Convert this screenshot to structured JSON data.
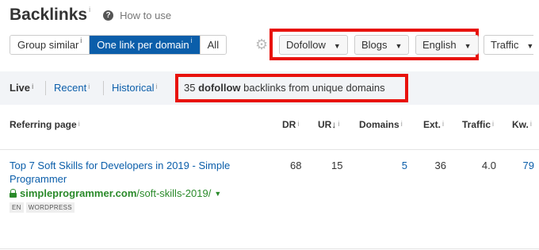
{
  "header": {
    "title": "Backlinks",
    "title_sup": "i",
    "how_to_use": "How to use",
    "help_icon": "?"
  },
  "grouping": {
    "buttons": [
      {
        "label": "Group similar",
        "sup": "i"
      },
      {
        "label": "One link per domain",
        "sup": "i"
      },
      {
        "label": "All",
        "sup": ""
      }
    ],
    "active": "One link per domain"
  },
  "filters": {
    "link_type": "Dofollow",
    "category": "Blogs",
    "language": "English",
    "traffic": "Traffic"
  },
  "tabs": {
    "items": [
      {
        "label": "Live",
        "sup": "i"
      },
      {
        "label": "Recent",
        "sup": "i"
      },
      {
        "label": "Historical",
        "sup": "i"
      }
    ],
    "active": "Live"
  },
  "summary": {
    "count": "35",
    "type": "dofollow",
    "rest": " backlinks from unique domains"
  },
  "table": {
    "columns": [
      {
        "label": "Referring page",
        "sup": "i"
      },
      {
        "label": "DR",
        "sup": "i"
      },
      {
        "label": "UR",
        "sort": "↓",
        "sup": "i"
      },
      {
        "label": "Domains",
        "sup": "i"
      },
      {
        "label": "Ext.",
        "sup": "i"
      },
      {
        "label": "Traffic",
        "sup": "i"
      },
      {
        "label": "Kw.",
        "sup": "i"
      }
    ],
    "rows": [
      {
        "title": "Top 7 Soft Skills for Developers in 2019 - Simple Programmer",
        "domain": "simpleprogrammer.com",
        "path": "/soft-skills-2019/",
        "tags": [
          "EN",
          "WORDPRESS"
        ],
        "dr": "68",
        "ur": "15",
        "domains": "5",
        "ext": "36",
        "traffic": "4.0",
        "kw": "79"
      }
    ]
  },
  "colors": {
    "accent": "#0b5eaa",
    "highlight": "#e8120c",
    "url_green": "#2a8a2a"
  }
}
